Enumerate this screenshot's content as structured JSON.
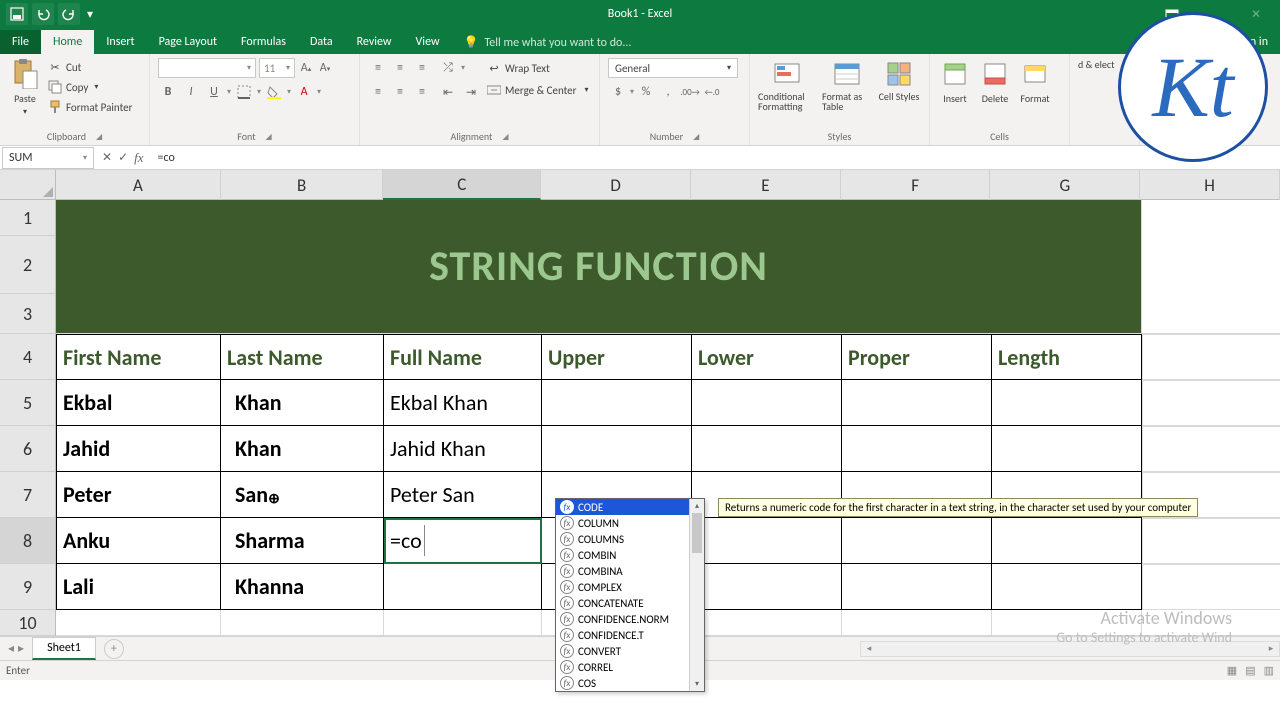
{
  "titlebar": {
    "title": "Book1 - Excel"
  },
  "tabs": {
    "file": "File",
    "home": "Home",
    "insert": "Insert",
    "pagelayout": "Page Layout",
    "formulas": "Formulas",
    "data": "Data",
    "review": "Review",
    "view": "View",
    "tellme": "Tell me what you want to do...",
    "signin": "Sign in"
  },
  "ribbon": {
    "clipboard": {
      "label": "Clipboard",
      "paste": "Paste",
      "cut": "Cut",
      "copy": "Copy",
      "fp": "Format Painter"
    },
    "font": {
      "label": "Font",
      "name": "",
      "size": "11"
    },
    "alignment": {
      "label": "Alignment",
      "wrap": "Wrap Text",
      "merge": "Merge & Center"
    },
    "number": {
      "label": "Number",
      "format": "General"
    },
    "styles": {
      "label": "Styles",
      "cf": "Conditional Formatting",
      "fat": "Format as Table",
      "cs": "Cell Styles"
    },
    "cells": {
      "label": "Cells",
      "insert": "Insert",
      "delete": "Delete",
      "format": "Format"
    },
    "editing": {
      "label": "...",
      "find": "d & elect"
    }
  },
  "fbar": {
    "name": "SUM",
    "formula": "=co"
  },
  "grid": {
    "cols": [
      "A",
      "B",
      "C",
      "D",
      "E",
      "F",
      "G",
      "H"
    ],
    "rows": [
      "1",
      "2",
      "3",
      "4",
      "5",
      "6",
      "7",
      "8",
      "9",
      "10"
    ],
    "activeCol": "C",
    "title": "STRING FUNCTION",
    "headers": [
      "First Name",
      "Last Name",
      "Full Name",
      "Upper",
      "Lower",
      "Proper",
      "Length"
    ],
    "data": [
      [
        "Ekbal",
        "Khan",
        "Ekbal Khan",
        "",
        "",
        "",
        ""
      ],
      [
        "Jahid",
        "Khan",
        "Jahid Khan",
        "",
        "",
        "",
        ""
      ],
      [
        "Peter",
        "San",
        "Peter San",
        "",
        "",
        "",
        ""
      ],
      [
        "Anku",
        "Sharma",
        "=co",
        "",
        "",
        "",
        ""
      ],
      [
        "Lali",
        "Khanna",
        "",
        "",
        "",
        "",
        ""
      ]
    ],
    "editing_value": "=co"
  },
  "autocomplete": {
    "items": [
      "CODE",
      "COLUMN",
      "COLUMNS",
      "COMBIN",
      "COMBINA",
      "COMPLEX",
      "CONCATENATE",
      "CONFIDENCE.NORM",
      "CONFIDENCE.T",
      "CONVERT",
      "CORREL",
      "COS"
    ],
    "selected": "CODE",
    "tip": "Returns a numeric code for the first character in a text string, in the character set used by your computer"
  },
  "sheetbar": {
    "sheet": "Sheet1"
  },
  "statusbar": {
    "mode": "Enter"
  },
  "watermark": {
    "l1": "Activate Windows",
    "l2": "Go to Settings to activate Wind"
  },
  "logo": "Kt"
}
